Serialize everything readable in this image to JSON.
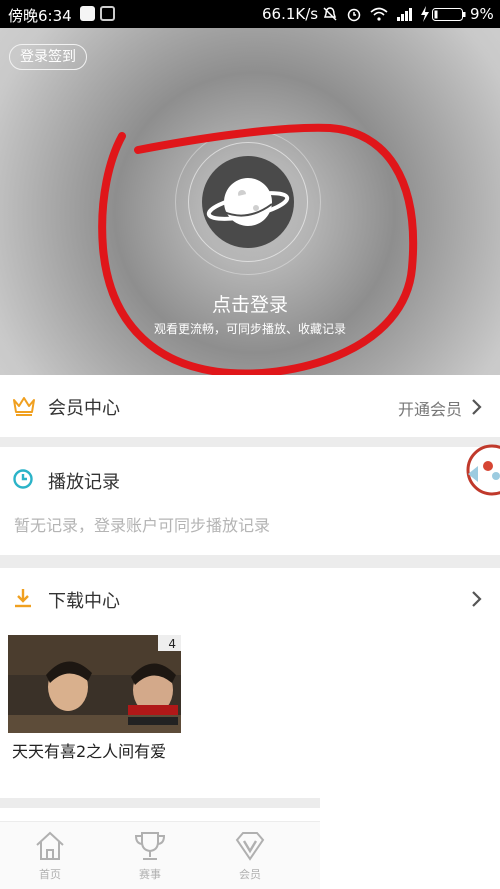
{
  "status_bar": {
    "time": "傍晚6:34",
    "net_speed": "66.1K/s",
    "battery": "9%",
    "icons": [
      "qq-icon",
      "notification-icon",
      "mute-icon",
      "alarm-icon",
      "wifi-icon",
      "signal-icon",
      "charging-icon",
      "battery-icon"
    ]
  },
  "hero": {
    "checkin_label": "登录签到",
    "login_title": "点击登录",
    "login_subtitle": "观看更流畅，可同步播放、收藏记录",
    "annotation_color": "#e0161a"
  },
  "member": {
    "title": "会员中心",
    "action": "开通会员",
    "icon": "crown-icon",
    "icon_color": "#f0a020"
  },
  "history": {
    "title": "播放记录",
    "empty_hint": "暂无记录，登录账户可同步播放记录",
    "icon": "clock-icon",
    "icon_color": "#2bb3c8"
  },
  "download": {
    "title": "下载中心",
    "icon": "download-icon",
    "icon_color": "#f0a020",
    "items": [
      {
        "title": "天天有喜2之人间有爱",
        "badge": "4"
      }
    ]
  },
  "tabbar": {
    "items": [
      {
        "label": "首页",
        "icon": "home-icon"
      },
      {
        "label": "赛事",
        "icon": "trophy-icon"
      },
      {
        "label": "会员",
        "icon": "vip-diamond-icon"
      }
    ]
  }
}
